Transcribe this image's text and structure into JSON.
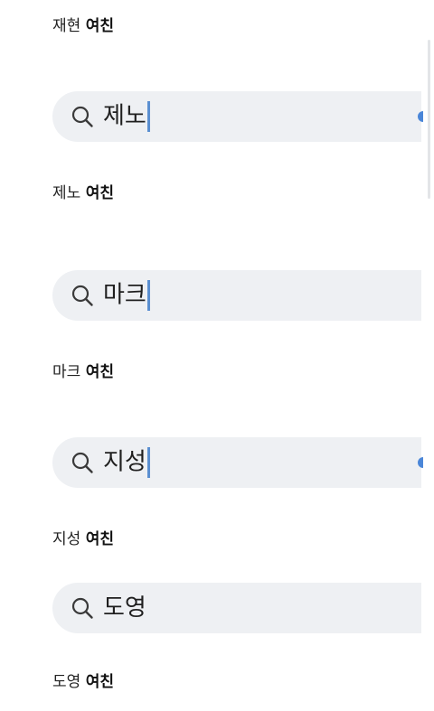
{
  "blocks": [
    {
      "suggestion": {
        "name": "재현",
        "tag": "여친"
      },
      "search": {
        "query": "제노",
        "has_caret": true,
        "has_edge_dot": true
      }
    },
    {
      "suggestion": {
        "name": "제노",
        "tag": "여친"
      },
      "search": {
        "query": "마크",
        "has_caret": true,
        "has_edge_dot": false
      }
    },
    {
      "suggestion": {
        "name": "마크",
        "tag": "여친"
      },
      "search": {
        "query": "지성",
        "has_caret": true,
        "has_edge_dot": true
      }
    },
    {
      "suggestion": {
        "name": "지성",
        "tag": "여친"
      },
      "search": {
        "query": "도영",
        "has_caret": false,
        "has_edge_dot": false
      }
    }
  ],
  "final_suggestion": {
    "name": "도영",
    "tag": "여친"
  },
  "colors": {
    "search_bg": "#eef0f3",
    "caret": "#5b8fd1",
    "accent_dot": "#4a86d8"
  },
  "icons": {
    "search": "search-icon"
  }
}
